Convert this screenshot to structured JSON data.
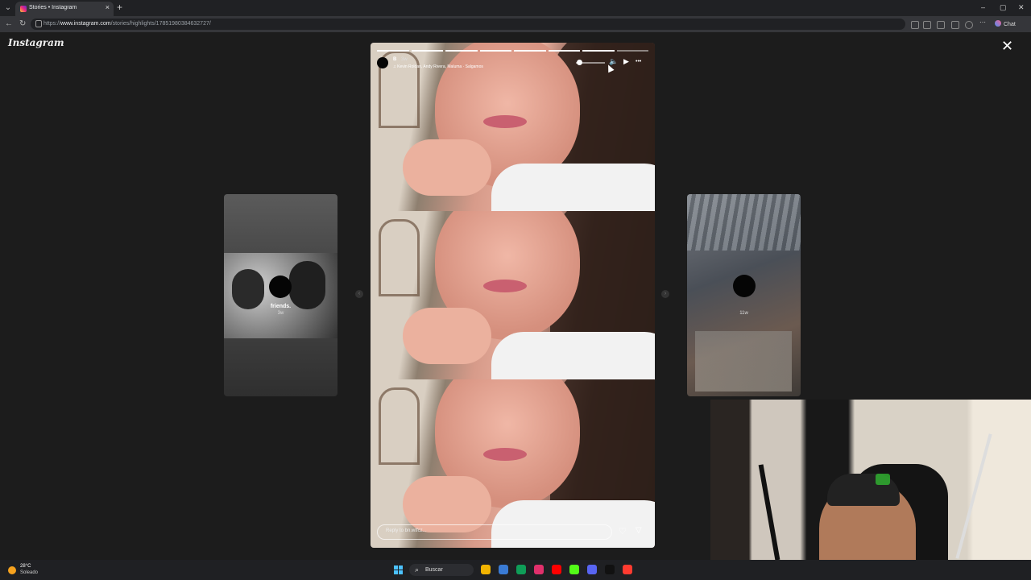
{
  "browser": {
    "tab_title": "Stories • Instagram",
    "tab_close": "×",
    "new_tab": "+",
    "url_prefix": "https://",
    "url_host": "www.instagram.com",
    "url_path": "/stories/highlights/17851980384632727/",
    "chat_label": "Chat",
    "win_min": "–",
    "win_max": "▢",
    "win_close": "✕"
  },
  "instagram": {
    "logo_text": "Instagram",
    "close_symbol": "✕",
    "left_story": {
      "name": "friends.",
      "time": "3w"
    },
    "right_story": {
      "time": "11w"
    },
    "main_story": {
      "username": "B",
      "time": "3w",
      "music": "♫ Kevin Roldan, Andy Rivera, Maluma · Salgamos",
      "progress_segments": 8,
      "progress_done": 7,
      "volume_level": 0.1,
      "reply_placeholder": "Reply to bn.wtfcz...",
      "mute_icon": "🔈",
      "play_icon": "▶",
      "more_icon": "•••",
      "heart_icon": "♡",
      "send_icon": "▽"
    },
    "prev_arrow": "‹",
    "next_arrow": "›"
  },
  "taskbar": {
    "weather_temp": "28°C",
    "weather_cond": "Soleado",
    "search_label": "Buscar",
    "search_icon": "⌕",
    "app_colors": [
      "#f2b400",
      "#3a7bd5",
      "#0f9d58",
      "#e1306c",
      "#ff0000",
      "#53fc18",
      "#5865f2",
      "#111111",
      "#ff3b30"
    ]
  }
}
